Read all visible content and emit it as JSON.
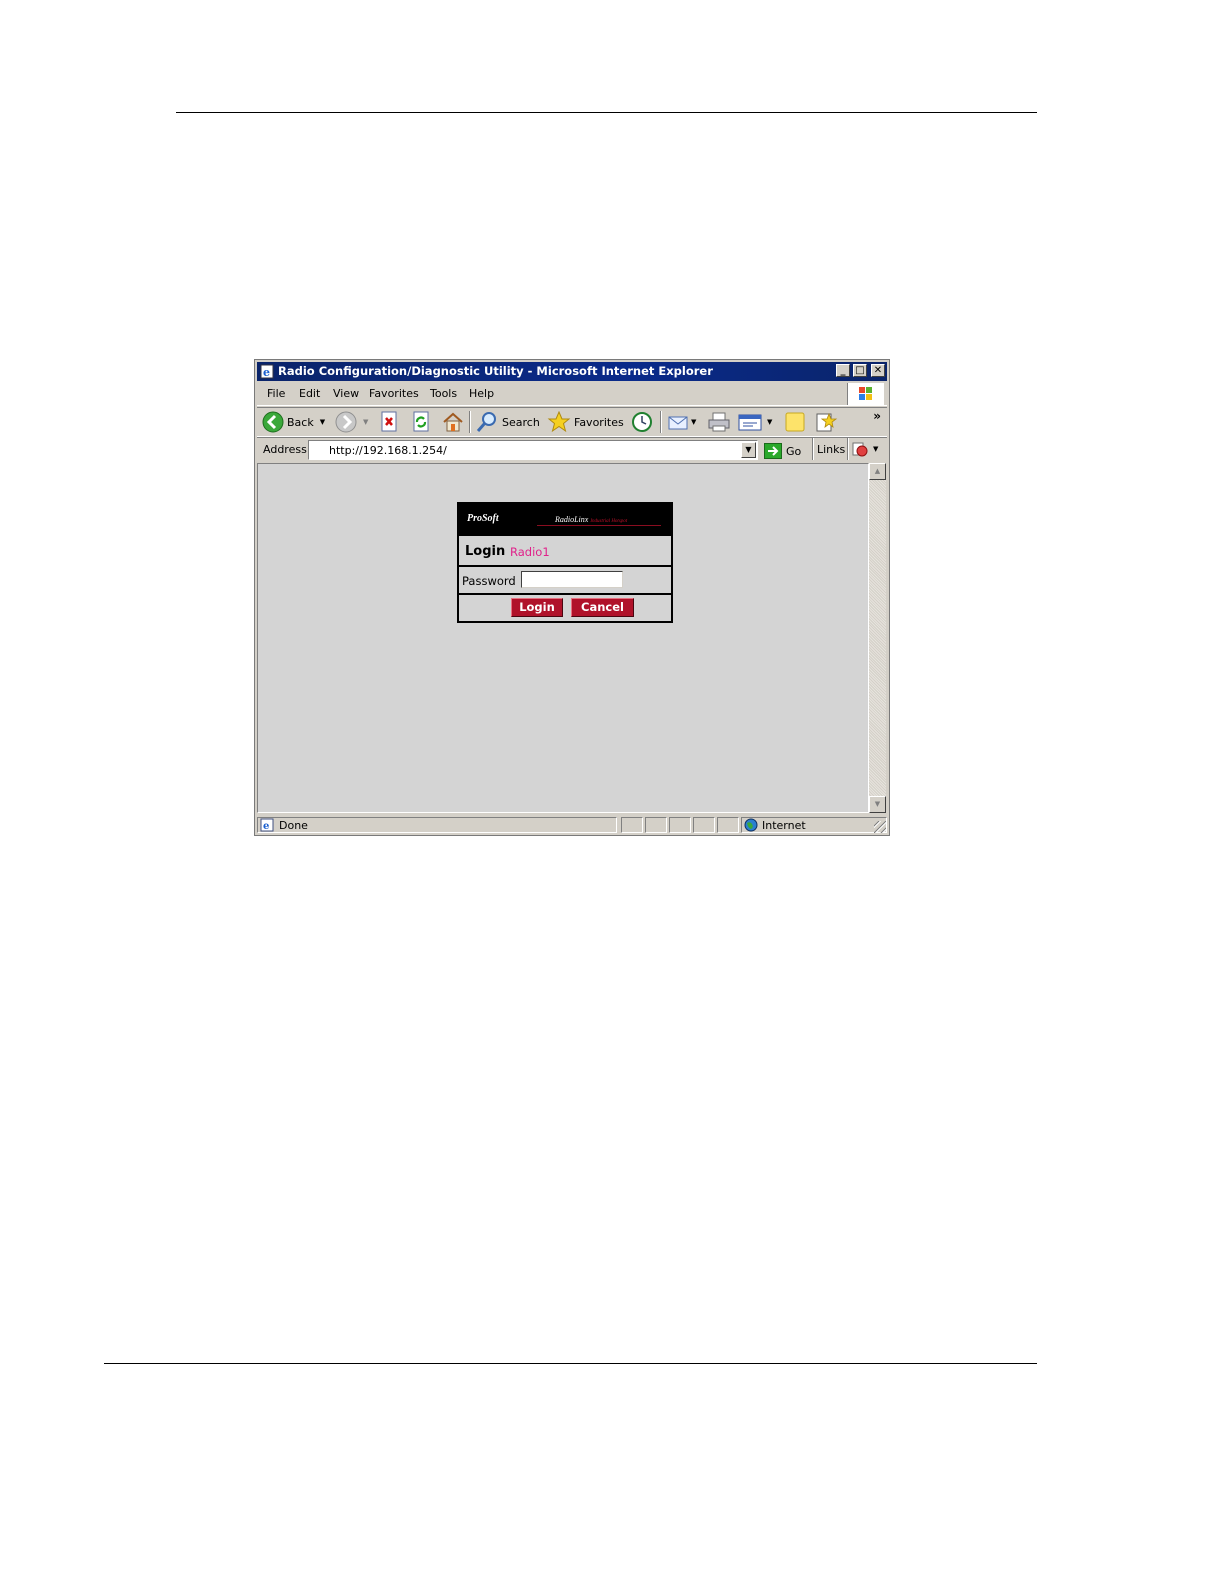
{
  "window": {
    "title": "Radio Configuration/Diagnostic Utility - Microsoft Internet Explorer"
  },
  "menu": [
    "File",
    "Edit",
    "View",
    "Favorites",
    "Tools",
    "Help"
  ],
  "toolbar": {
    "back_label": "Back",
    "search_label": "Search",
    "favorites_label": "Favorites",
    "more": "»"
  },
  "address": {
    "label": "Address",
    "url": "http://192.168.1.254/",
    "go_label": "Go",
    "links_label": "Links"
  },
  "login": {
    "brand_left": "ProSoft",
    "brand_right": "RadioLinx",
    "brand_tag": "Industrial Hotspot",
    "title": "Login",
    "radio_name": "Radio1",
    "password_label": "Password",
    "password_value": "",
    "login_button": "Login",
    "cancel_button": "Cancel"
  },
  "status": {
    "text": "Done",
    "zone": "Internet"
  },
  "colors": {
    "titlebar": "#0a246a",
    "button_red": "#b0122a",
    "radio_name": "#e0218a"
  }
}
